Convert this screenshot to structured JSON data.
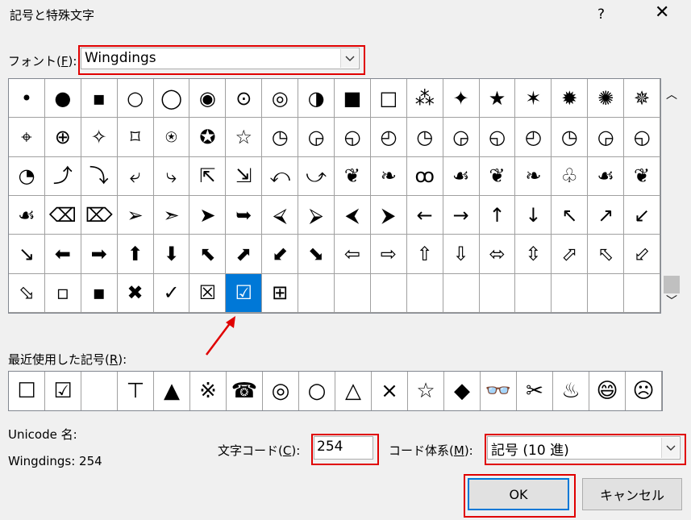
{
  "window": {
    "title": "記号と特殊文字",
    "help": "?",
    "close": "✕"
  },
  "font": {
    "label_prefix": "フォント(",
    "label_key": "F",
    "label_suffix": "):",
    "value": "Wingdings"
  },
  "symbols": [
    "•",
    "●",
    "▪",
    "○",
    "◯",
    "◉",
    "⊙",
    "◎",
    "◑",
    "■",
    "□",
    "⁂",
    "✦",
    "★",
    "✶",
    "✹",
    "✺",
    "✵",
    "⌖",
    "⊕",
    "✧",
    "⌑",
    "⍟",
    "✪",
    "☆",
    "◷",
    "◶",
    "◵",
    "◴",
    "◷",
    "◶",
    "◵",
    "◴",
    "◷",
    "◶",
    "◵",
    "◔",
    "⤴",
    "⤵",
    "⤶",
    "⤷",
    "⇱",
    "⇲",
    "⤺",
    "⤻",
    "❦",
    "❧",
    "ꝏ",
    "☙",
    "❦",
    "❧",
    "♧",
    "☙",
    "❦",
    "☙",
    "⌫",
    "⌦",
    "➢",
    "➣",
    "➤",
    "➥",
    "⮘",
    "⮚",
    "⮜",
    "⮞",
    "←",
    "→",
    "↑",
    "↓",
    "↖",
    "↗",
    "↙",
    "↘",
    "⬅",
    "➡",
    "⬆",
    "⬇",
    "⬉",
    "⬈",
    "⬋",
    "⬊",
    "⇦",
    "⇨",
    "⇧",
    "⇩",
    "⬄",
    "⇳",
    "⬀",
    "⬁",
    "⬃",
    "⬂",
    "▫",
    "▪",
    "✖",
    "✓",
    "☒",
    "☑",
    "⊞",
    "",
    "",
    "",
    "",
    "",
    "",
    "",
    "",
    "",
    ""
  ],
  "selected_index": 96,
  "recent": {
    "label_prefix": "最近使用した記号(",
    "label_key": "R",
    "label_suffix": "):",
    "items": [
      "☐",
      "☑",
      "",
      "⊤",
      "▲",
      "※",
      "☎",
      "◎",
      "○",
      "△",
      "×",
      "☆",
      "◆",
      "👓",
      "✂",
      "♨",
      "😄",
      "☹"
    ]
  },
  "unicode": {
    "label": "Unicode 名:",
    "value": "Wingdings: 254"
  },
  "char_code": {
    "label_prefix": "文字コード(",
    "label_key": "C",
    "label_suffix": "):",
    "value": "254"
  },
  "code_system": {
    "label_prefix": "コード体系(",
    "label_key": "M",
    "label_suffix": "):",
    "value": "記号 (10 進)"
  },
  "buttons": {
    "ok": "OK",
    "cancel": "キャンセル"
  },
  "colors": {
    "highlight": "#e00000",
    "selection": "#0078d7",
    "arrow": "#e00000"
  }
}
